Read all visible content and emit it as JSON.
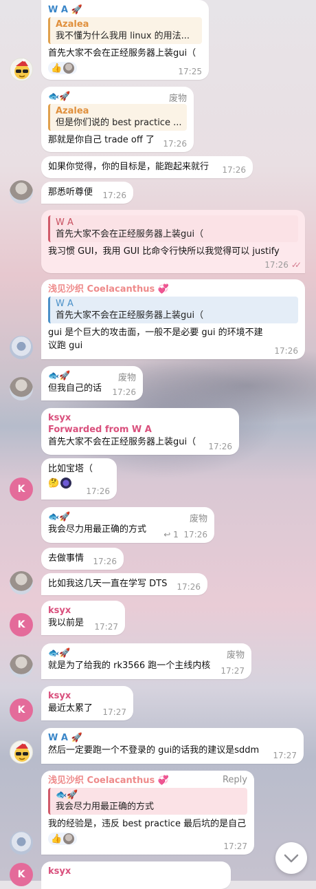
{
  "messages": [
    {
      "sender": "W A",
      "sender_emoji": "🚀",
      "reply": {
        "name": "Azalea",
        "text": "我不懂为什么我用 linux 的用法..."
      },
      "text": "首先大家不会在正经服务器上装gui（",
      "reaction": "👍",
      "time": "17:25"
    },
    {
      "sender_icon": "🐟🚀",
      "tag": "废物",
      "reply": {
        "name": "Azalea",
        "text": "但是你们说的 best practice ..."
      },
      "text": "那就是你自己 trade off 了",
      "time": "17:26"
    },
    {
      "text": "如果你觉得，你的目标是，能跑起来就行",
      "time": "17:26"
    },
    {
      "text": "那悉听尊便",
      "time": "17:26"
    },
    {
      "reply": {
        "name": "W A",
        "text": "首先大家不会在正经服务器上装gui（"
      },
      "text": "我习惯 GUI，我用 GUI 比命令行快所以我觉得可以 justify",
      "time": "17:26",
      "status_icon": "double-check"
    },
    {
      "sender": "浅见沙织 Coelacanthus",
      "sender_emoji": "💞",
      "reply": {
        "name": "W A",
        "text": "首先大家不会在正经服务器上装gui（"
      },
      "text": "gui 是个巨大的攻击面，一般不是必要 gui 的环境不建议跑 gui",
      "time": "17:26"
    },
    {
      "sender_icon": "🐟🚀",
      "tag": "废物",
      "text": "但我自己的话",
      "time": "17:26"
    },
    {
      "sender": "ksyx",
      "forwarded": "Forwarded from W A",
      "text": "首先大家不会在正经服务器上装gui（",
      "time": "17:26"
    },
    {
      "text": "比如宝塔（",
      "reaction": "🤔",
      "time": "17:26"
    },
    {
      "sender_icon": "🐟🚀",
      "tag": "废物",
      "text": "我会尽力用最正确的方式",
      "reply_count": "1",
      "time": "17:26"
    },
    {
      "text": "去做事情",
      "time": "17:26"
    },
    {
      "text": "比如我这几天一直在学写 DTS",
      "time": "17:26"
    },
    {
      "sender": "ksyx",
      "text": "我以前是",
      "time": "17:27"
    },
    {
      "sender_icon": "🐟🚀",
      "tag": "废物",
      "text": "就是为了给我的 rk3566 跑一个主线内核",
      "time": "17:27"
    },
    {
      "sender": "ksyx",
      "text": "最近太累了",
      "time": "17:27"
    },
    {
      "sender": "W A",
      "sender_emoji": "🚀",
      "text": "然后一定要跑一个不登录的 gui的话我的建议是sddm",
      "time": "17:27"
    },
    {
      "sender": "浅见沙织 Coelacanthus",
      "sender_emoji": "💞",
      "action": "Reply",
      "reply": {
        "name": "🐟🚀",
        "text": "我会尽力用最正确的方式"
      },
      "text": "我的经验是，违反 best practice 最后坑的是自己",
      "reaction": "👍",
      "time": "17:27"
    },
    {
      "sender": "ksyx"
    }
  ],
  "avatars": {
    "k_letter": "K"
  },
  "icons": {
    "scroll_down": "chevron-down-icon",
    "read_status": "double-check-icon"
  },
  "colors": {
    "accent_pink": "#d94f7c",
    "reply_orange": "#e0a04d",
    "own_bubble": "#fde8ec"
  }
}
